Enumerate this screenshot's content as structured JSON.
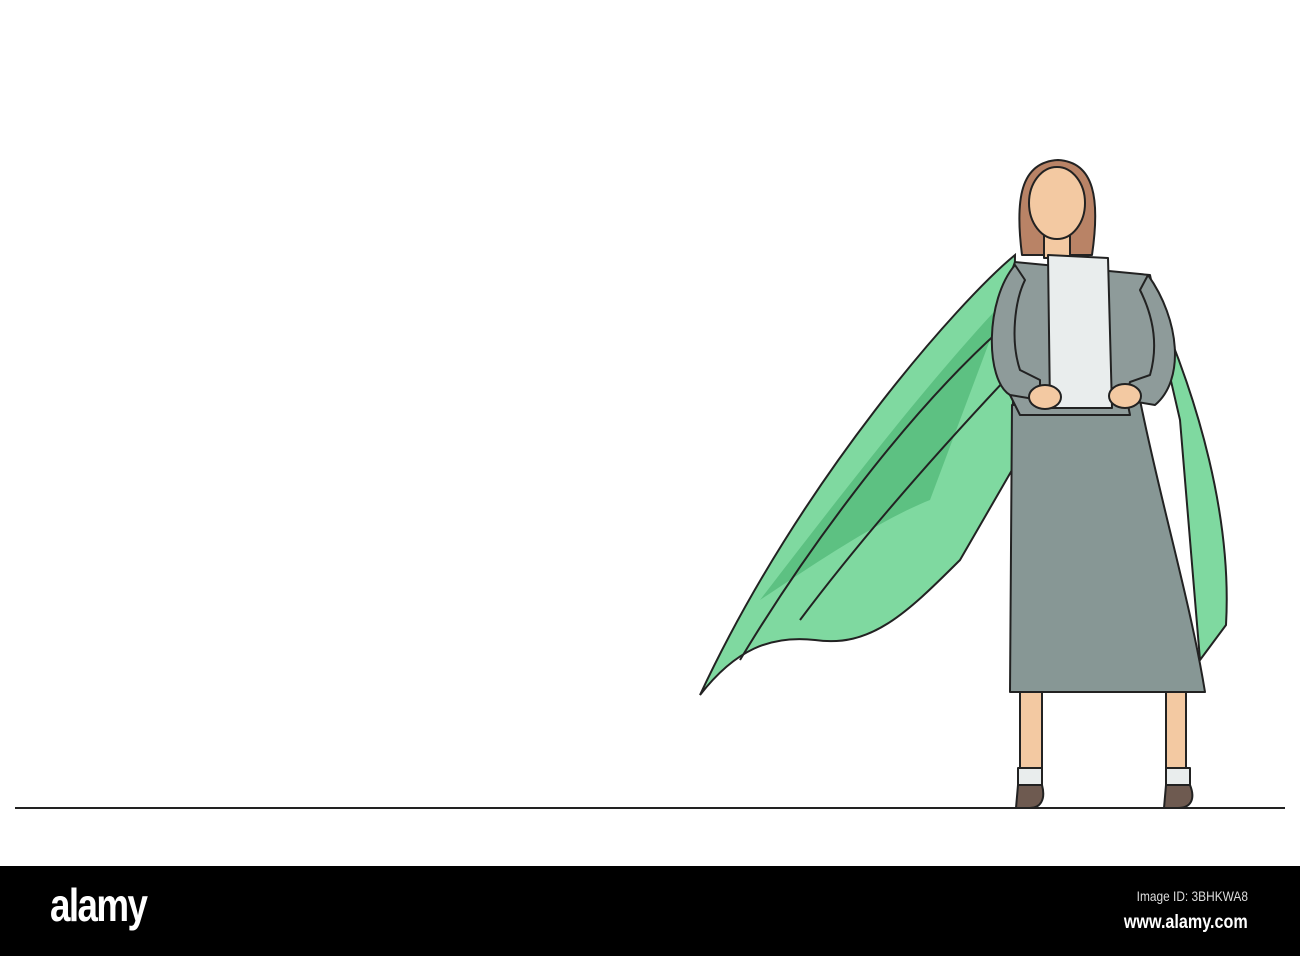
{
  "footer": {
    "logo": "alamy",
    "image_id": "Image ID: 3BHKWA8",
    "url": "www.alamy.com"
  },
  "colors": {
    "cape_light": "#7fd9a0",
    "cape_dark": "#5dc182",
    "suit": "#8e9b9a",
    "skirt": "#879795",
    "shirt": "#e9eded",
    "skin": "#f3c9a2",
    "hair": "#b98366",
    "shoes": "#6e5a50",
    "footer_bg": "#000000"
  }
}
